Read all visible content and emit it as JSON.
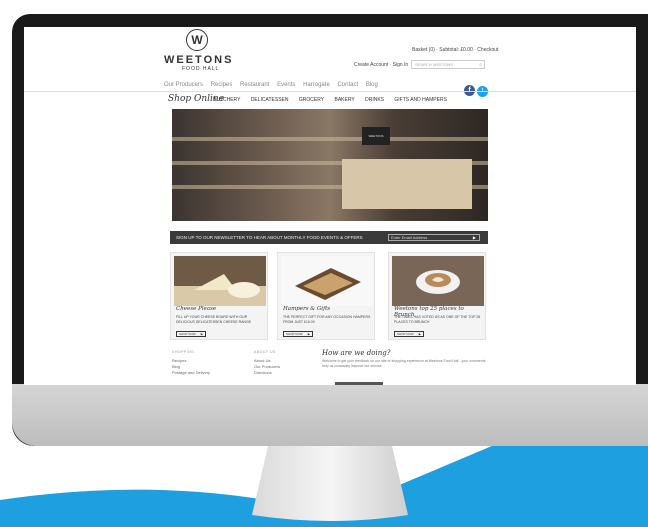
{
  "colors": {
    "brand_blue": "#1e9fe0",
    "bezel": "#1a1a1a",
    "newsletter_bg": "#3a3a3a",
    "facebook": "#3b5998",
    "twitter": "#1da1f2"
  },
  "header": {
    "logo_letter": "W",
    "brand_name": "WEETONS",
    "brand_sub": "FOOD HALL",
    "basket_text": "Basket (0) · Subtotal: £0.00 · Checkout",
    "account_text": "Create Account · Sign In",
    "search_placeholder": "SEARCH WEETONS",
    "search_icon": "search-icon"
  },
  "top_nav": [
    "Our Producers",
    "Recipes",
    "Restaurant",
    "Events",
    "Harrogate",
    "Contact",
    "Blog"
  ],
  "social": {
    "facebook_icon": "f",
    "twitter_icon": "t"
  },
  "shop": {
    "title": "Shop Online",
    "categories": [
      "BUTCHERY",
      "DELICATESSEN",
      "GROCERY",
      "BAKERY",
      "DRINKS",
      "GIFTS AND HAMPERS"
    ]
  },
  "hero": {
    "sign_text": "WEETONS"
  },
  "newsletter": {
    "text": "SIGN UP TO OUR NEWSLETTER TO HEAR ABOUT MONTHLY FOOD EVENTS & OFFERS",
    "placeholder": "Enter Email Address",
    "arrow": "▶"
  },
  "promos": [
    {
      "title": "Cheese Please",
      "desc": "FILL UP YOUR CHEESE BOARD WITH OUR DELICIOUS DELICATESSEN CHEESE RANGE",
      "button": "SHOP NOW"
    },
    {
      "title": "Hampers & Gifts",
      "desc": "THE PERFECT GIFT FOR ANY OCCASION HAMPERS FROM JUST £16.00",
      "button": "SHOP NOW"
    },
    {
      "title": "Weetons top 25 places to Brunch",
      "desc": "THE TIMES HAS VOTED US AS ONE OF THE TOP 25 PLACES TO BRUNCH",
      "button": "SHOP NOW"
    }
  ],
  "footer": {
    "col1": {
      "heading": "SHOPPING",
      "links": [
        "Recipes",
        "Blog",
        "Postage and Delivery"
      ]
    },
    "col2": {
      "heading": "ABOUT US",
      "links": [
        "About Us",
        "Our Producers",
        "Directions"
      ]
    },
    "feedback_title": "How are we doing?",
    "feedback_text": "Welcome to get your feedback on our site or shopping experience at Weetons Food Hall - your comments help us constantly improve our service."
  }
}
